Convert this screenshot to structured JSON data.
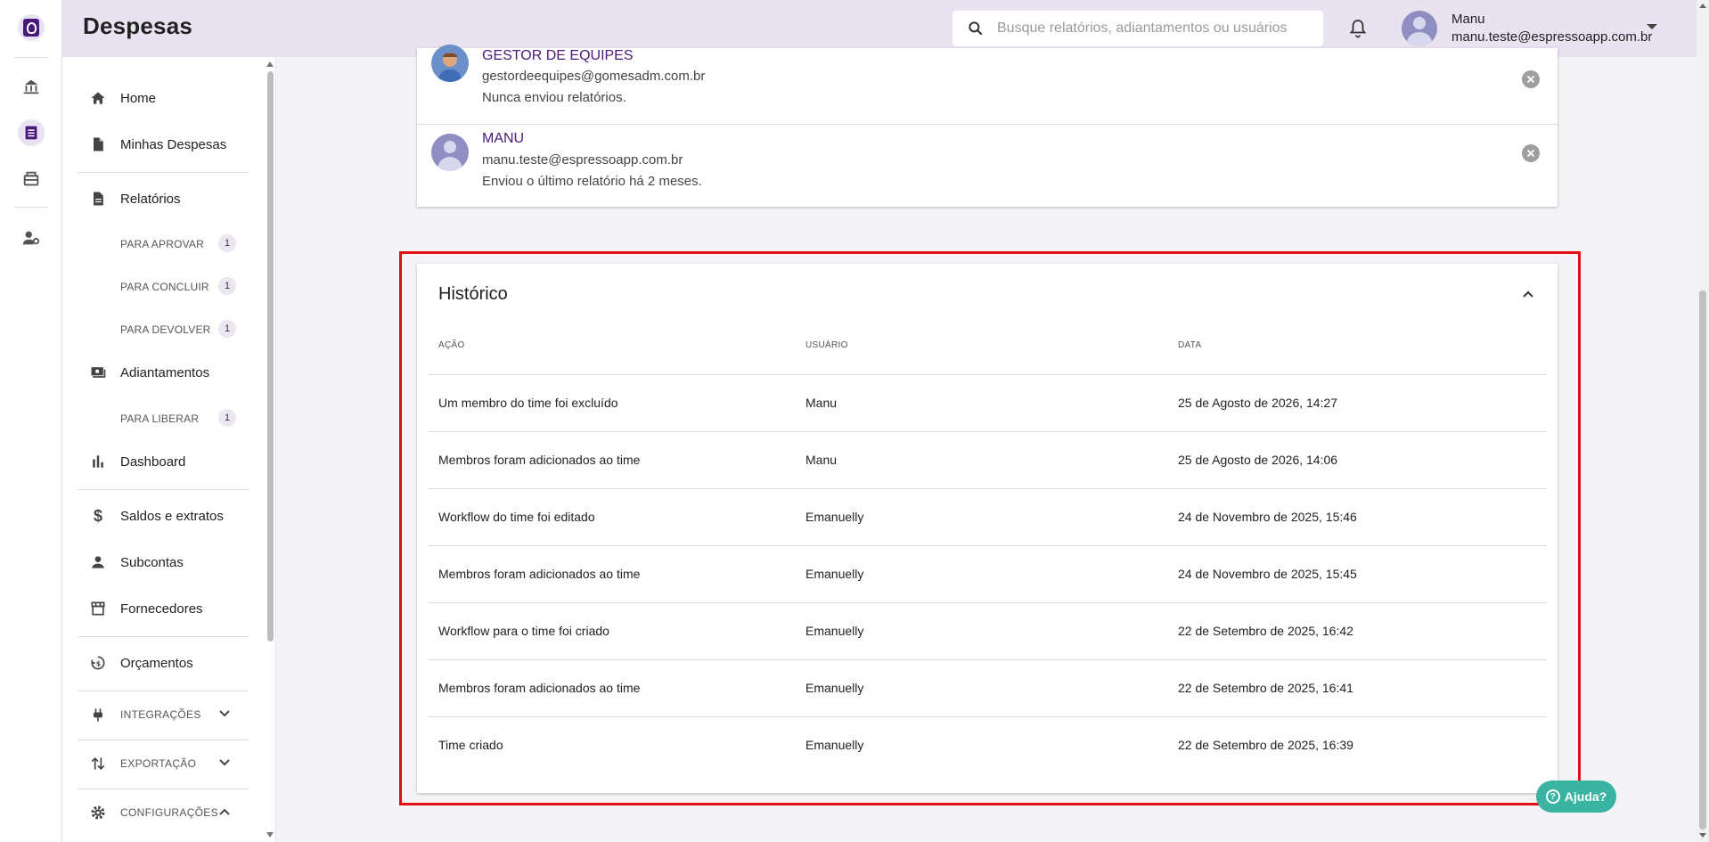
{
  "header": {
    "title": "Despesas",
    "search_placeholder": "Busque relatórios, adiantamentos ou usuários",
    "user_name": "Manu",
    "user_email": "manu.teste@espressoapp.com.br"
  },
  "rail": {
    "icons": [
      "logo-icon",
      "bank-icon",
      "list-icon",
      "cards-icon",
      "user-settings-icon"
    ]
  },
  "sidebar": {
    "items": [
      {
        "label": "Home",
        "icon": "home-icon"
      },
      {
        "label": "Minhas Despesas",
        "icon": "document-icon"
      },
      {
        "label": "Relatórios",
        "icon": "report-icon"
      },
      {
        "label": "Adiantamentos",
        "icon": "money-icon"
      },
      {
        "label": "Dashboard",
        "icon": "bar-chart-icon"
      },
      {
        "label": "Saldos e extratos",
        "icon": "dollar-icon"
      },
      {
        "label": "Subcontas",
        "icon": "person-icon"
      },
      {
        "label": "Fornecedores",
        "icon": "store-icon"
      },
      {
        "label": "Orçamentos",
        "icon": "budget-icon"
      }
    ],
    "sub_items": [
      {
        "label": "PARA APROVAR",
        "badge": "1"
      },
      {
        "label": "PARA CONCLUIR",
        "badge": "1"
      },
      {
        "label": "PARA DEVOLVER",
        "badge": "1"
      },
      {
        "label": "PARA LIBERAR",
        "badge": "1"
      }
    ],
    "sections": [
      {
        "label": "INTEGRAÇÕES",
        "icon": "plug-icon"
      },
      {
        "label": "EXPORTAÇÃO",
        "icon": "export-icon"
      },
      {
        "label": "CONFIGURAÇÕES",
        "icon": "gear-icon"
      }
    ]
  },
  "members": [
    {
      "name": "GESTOR DE EQUIPES",
      "email": "gestordeequipes@gomesadm.com.br",
      "info": "Nunca enviou relatórios."
    },
    {
      "name": "MANU",
      "email": "manu.teste@espressoapp.com.br",
      "info": "Enviou o último relatório há 2 meses."
    }
  ],
  "history": {
    "title": "Histórico",
    "columns": [
      "AÇÃO",
      "USUÁRIO",
      "DATA"
    ],
    "rows": [
      [
        "Um membro do time foi excluído",
        "Manu",
        "25 de Agosto de 2026, 14:27"
      ],
      [
        "Membros foram adicionados ao time",
        "Manu",
        "25 de Agosto de 2026, 14:06"
      ],
      [
        "Workflow do time foi editado",
        "Emanuelly",
        "24 de Novembro de 2025, 15:46"
      ],
      [
        "Membros foram adicionados ao time",
        "Emanuelly",
        "24 de Novembro de 2025, 15:45"
      ],
      [
        "Workflow para o time foi criado",
        "Emanuelly",
        "22 de Setembro de 2025, 16:42"
      ],
      [
        "Membros foram adicionados ao time",
        "Emanuelly",
        "22 de Setembro de 2025, 16:41"
      ],
      [
        "Time criado",
        "Emanuelly",
        "22 de Setembro de 2025, 16:39"
      ]
    ]
  },
  "help": {
    "label": "Ajuda?"
  },
  "colors": {
    "brand": "#4a1a7a",
    "header_bg": "#e8e2f1",
    "highlight": "#e01010",
    "help": "#3bb3a3"
  }
}
